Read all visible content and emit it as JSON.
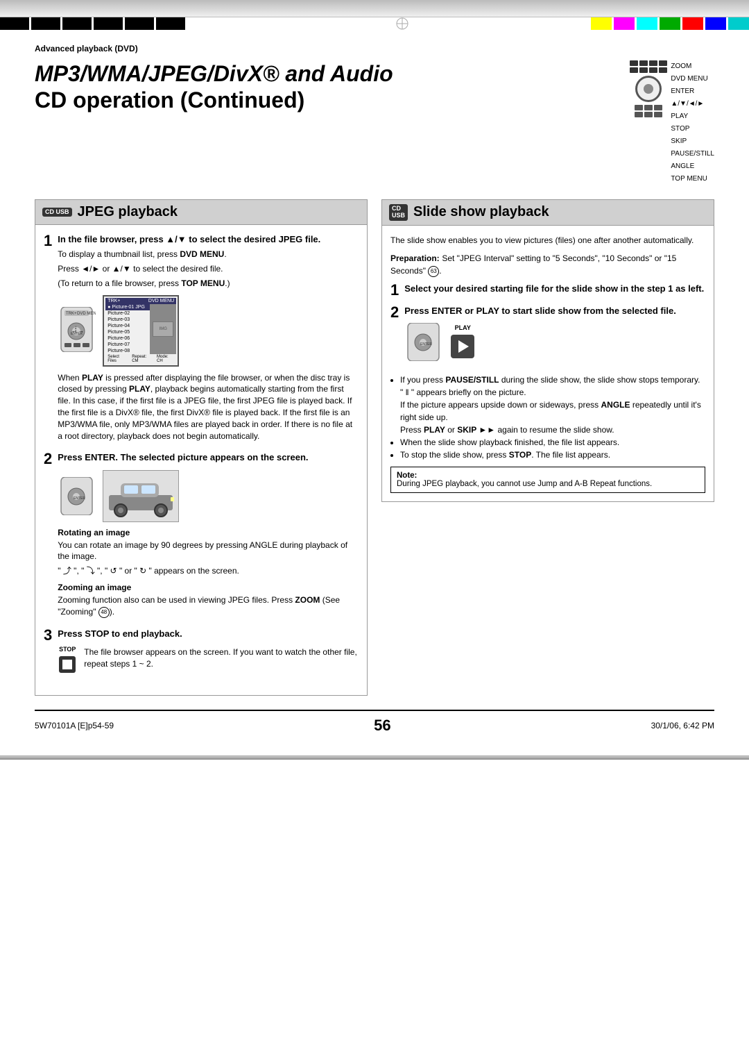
{
  "page": {
    "number": "56",
    "footer_left": "5W70101A [E]p54-59",
    "footer_center": "56",
    "footer_right": "30/1/06, 6:42 PM"
  },
  "breadcrumb": "Advanced playback (DVD)",
  "title": {
    "line1": "MP3/WMA/JPEG/DivX® and Audio",
    "line2": "CD operation (Continued)"
  },
  "remote_labels": [
    "ZOOM",
    "DVD MENU",
    "ENTER",
    "▲/▼/◄/►",
    "PLAY",
    "STOP",
    "SKIP",
    "PAUSE/STILL",
    "ANGLE",
    "TOP MENU"
  ],
  "jpeg_section": {
    "badge": "CD\nUSB",
    "title": "JPEG playback",
    "step1_heading": "In the file browser, press ▲/▼ to select the desired JPEG file.",
    "step1_sub1": "To display a thumbnail list, press DVD MENU.",
    "step1_sub2": "Press ◄/► or ▲/▼ to select the desired file.",
    "step1_sub3": "(To return to a file browser, press TOP MENU.)",
    "step1_body": "When PLAY is pressed after displaying the file browser, or when the disc tray is closed by pressing PLAY, playback begins automatically starting from the first file. In this case, if the first file is a JPEG file, the first JPEG file is played back. If the first file is a DivX® file, the first DivX® file is played back. If the first file is an MP3/WMA file, only MP3/WMA files are played back in order. If there is no file at a root directory, playback does not begin automatically.",
    "step2_heading": "Press ENTER. The selected picture appears on the screen.",
    "rotating_title": "Rotating an image",
    "rotating_body": "You can rotate an image by 90 degrees by pressing ANGLE during playback of the image.",
    "rotating_symbols": "\" ⤴+ \", \" ⤵ \", \" ↺ \" or \" ↻ \" appears on the screen.",
    "zooming_title": "Zooming an image",
    "zooming_body": "Zooming function also can be used in viewing JPEG files. Press ZOOM (See \"Zooming\" 48).",
    "step3_heading": "Press STOP to end playback.",
    "step3_body": "The file browser appears on the screen. If you want to watch the other file, repeat steps 1 ~ 2."
  },
  "slideshow_section": {
    "badge": "CD\nUSB",
    "title": "Slide show playback",
    "intro": "The slide show enables you to view pictures (files) one after another automatically.",
    "prep_title": "Preparation:",
    "prep_body": "Set \"JPEG Interval\" setting to \"5 Seconds\", \"10 Seconds\" or \"15 Seconds\" 63.",
    "step1_heading": "Select your desired starting file for the slide show in the step 1 as left.",
    "step2_heading": "Press ENTER or PLAY to start slide show from the selected file.",
    "bullet1": "If you press PAUSE/STILL during the slide show, the slide show stops temporary. \" ‖ \" appears briefly on the picture.",
    "bullet1b": "If the picture appears upside down or sideways, press ANGLE repeatedly until it's right side up.",
    "bullet1c": "Press PLAY or SKIP ►► again to resume the slide show.",
    "bullet2": "When the slide show playback finished, the file list appears.",
    "bullet3": "To stop the slide show, press STOP. The file list appears.",
    "note_title": "Note:",
    "note_body": "During JPEG playback, you cannot use Jump and A-B Repeat functions."
  },
  "screen_content": {
    "header_left": "TRK+",
    "header_right": "DVD MENU",
    "rows": [
      "Picture-01",
      "Picture-02",
      "Picture-03",
      "Picture-04",
      "Picture-05",
      "Picture-06",
      "Picture-07",
      "Picture-08"
    ],
    "selected_row": 0,
    "side_labels": [
      "Select Files",
      "Repeat: CM",
      "Mode: CH"
    ]
  }
}
